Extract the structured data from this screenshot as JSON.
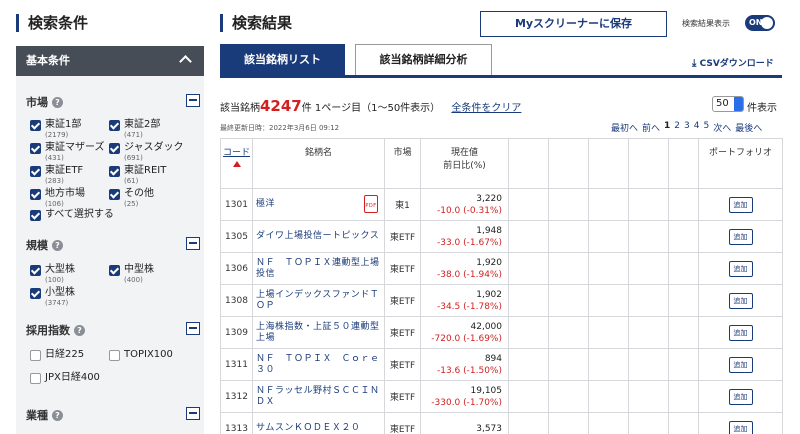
{
  "left": {
    "title": "検索条件",
    "basic_label": "基本条件",
    "market": {
      "label": "市場",
      "items": [
        {
          "label": "東証1部",
          "count": "(2179)",
          "checked": true
        },
        {
          "label": "東証2部",
          "count": "(471)",
          "checked": true
        },
        {
          "label": "東証マザーズ",
          "count": "(431)",
          "checked": true
        },
        {
          "label": "ジャスダック",
          "count": "(691)",
          "checked": true
        },
        {
          "label": "東証ETF",
          "count": "(283)",
          "checked": true
        },
        {
          "label": "東証REIT",
          "count": "(61)",
          "checked": true
        },
        {
          "label": "地方市場",
          "count": "(106)",
          "checked": true
        },
        {
          "label": "その他",
          "count": "(25)",
          "checked": true
        }
      ],
      "select_all": "すべて選択する"
    },
    "scale": {
      "label": "規模",
      "items": [
        {
          "label": "大型株",
          "count": "(100)",
          "checked": true
        },
        {
          "label": "中型株",
          "count": "(400)",
          "checked": true
        },
        {
          "label": "小型株",
          "count": "(3747)",
          "checked": true
        }
      ]
    },
    "index": {
      "label": "採用指数",
      "items": [
        {
          "label": "日経225",
          "checked": false
        },
        {
          "label": "TOPIX100",
          "checked": false
        },
        {
          "label": "JPX日経400",
          "checked": false
        }
      ]
    },
    "industry": {
      "label": "業種"
    }
  },
  "right": {
    "title": "検索結果",
    "save_button": "Myスクリーナーに保存",
    "toggle_label": "検索結果表示",
    "toggle_state": "ON",
    "tabs": [
      {
        "label": "該当銘柄リスト",
        "active": true
      },
      {
        "label": "該当銘柄詳細分析",
        "active": false
      }
    ],
    "csv_label": "CSVダウンロード",
    "hits_prefix": "該当銘柄",
    "hits_count": "4247",
    "hits_suffix": "件 1ページ目（1〜50件表示）",
    "clear_all": "全条件をクリア",
    "per_page_value": "50",
    "per_page_suffix": "件表示",
    "updated": "最終更新日時：2022年3月6日 09:12",
    "pager": {
      "first": "最初へ",
      "prev": "前へ",
      "pages": [
        "1",
        "2",
        "3",
        "4",
        "5"
      ],
      "next": "次へ",
      "last": "最後へ"
    },
    "table": {
      "headers": {
        "code": "コード",
        "name": "銘柄名",
        "market": "市場",
        "price_line1": "現在値",
        "price_line2": "前日比(%)",
        "portfolio": "ポートフォリオ"
      },
      "add_label": "追加",
      "rows": [
        {
          "code": "1301",
          "name": "極洋",
          "market": "東1",
          "price": "3,220",
          "change": "-10.0 (-0.31%)",
          "pdf": true
        },
        {
          "code": "1305",
          "name": "ダイワ上場投信ートピックス",
          "market": "東ETF",
          "price": "1,948",
          "change": "-33.0 (-1.67%)"
        },
        {
          "code": "1306",
          "name": "ＮＦ　ＴＯＰＩＸ連動型上場投信",
          "market": "東ETF",
          "price": "1,920",
          "change": "-38.0 (-1.94%)"
        },
        {
          "code": "1308",
          "name": "上場インデックスファンドＴＯＰ",
          "market": "東ETF",
          "price": "1,902",
          "change": "-34.5 (-1.78%)"
        },
        {
          "code": "1309",
          "name": "上海株指数・上証５０連動型上場",
          "market": "東ETF",
          "price": "42,000",
          "change": "-720.0 (-1.69%)"
        },
        {
          "code": "1311",
          "name": "ＮＦ　ＴＯＰＩＸ　Ｃｏｒｅ３０",
          "market": "東ETF",
          "price": "894",
          "change": "-13.6 (-1.50%)"
        },
        {
          "code": "1312",
          "name": "ＮＦラッセル野村ＳＣＣＩＮＤＸ",
          "market": "東ETF",
          "price": "19,105",
          "change": "-330.0 (-1.70%)"
        },
        {
          "code": "1313",
          "name": "サムスンＫＯＤＥＸ２０",
          "market": "東ETF",
          "price": "3,573",
          "change": ""
        }
      ]
    }
  }
}
